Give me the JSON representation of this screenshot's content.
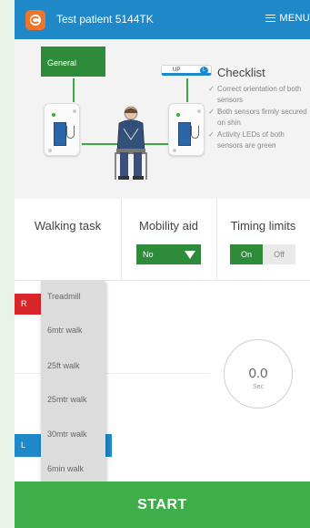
{
  "header": {
    "title": "Test patient 5144TK",
    "menu_label": "MENU"
  },
  "illustration": {
    "left_strap_label": "UP",
    "left_strap_badge": "R",
    "right_strap_label": "UP",
    "right_strap_badge": "L"
  },
  "checklist": {
    "title": "Checklist",
    "items": [
      "Correct orientation of both sensors",
      "Both sensors firmly secured on shin",
      "Activity LEDs of both sensors are green"
    ]
  },
  "options": {
    "walking_task_label": "Walking task",
    "walking_task_value": "General",
    "mobility_aid_label": "Mobility aid",
    "mobility_aid_value": "No",
    "timing_limits_label": "Timing limits",
    "timing_on": "On",
    "timing_off": "Off"
  },
  "dropdown": {
    "options": [
      "Treadmill",
      "6mtr walk",
      "25ft walk",
      "25mtr walk",
      "30mtr walk",
      "6min walk"
    ]
  },
  "lower": {
    "red_label": "R",
    "blue_label": "L"
  },
  "timer": {
    "value": "0.0",
    "unit": "Sec"
  },
  "start_label": "START",
  "colors": {
    "header": "#1e88c9",
    "accent_green": "#2e8b3a",
    "start_green": "#3fae49",
    "red": "#d9262b",
    "blue": "#1e88c9"
  }
}
